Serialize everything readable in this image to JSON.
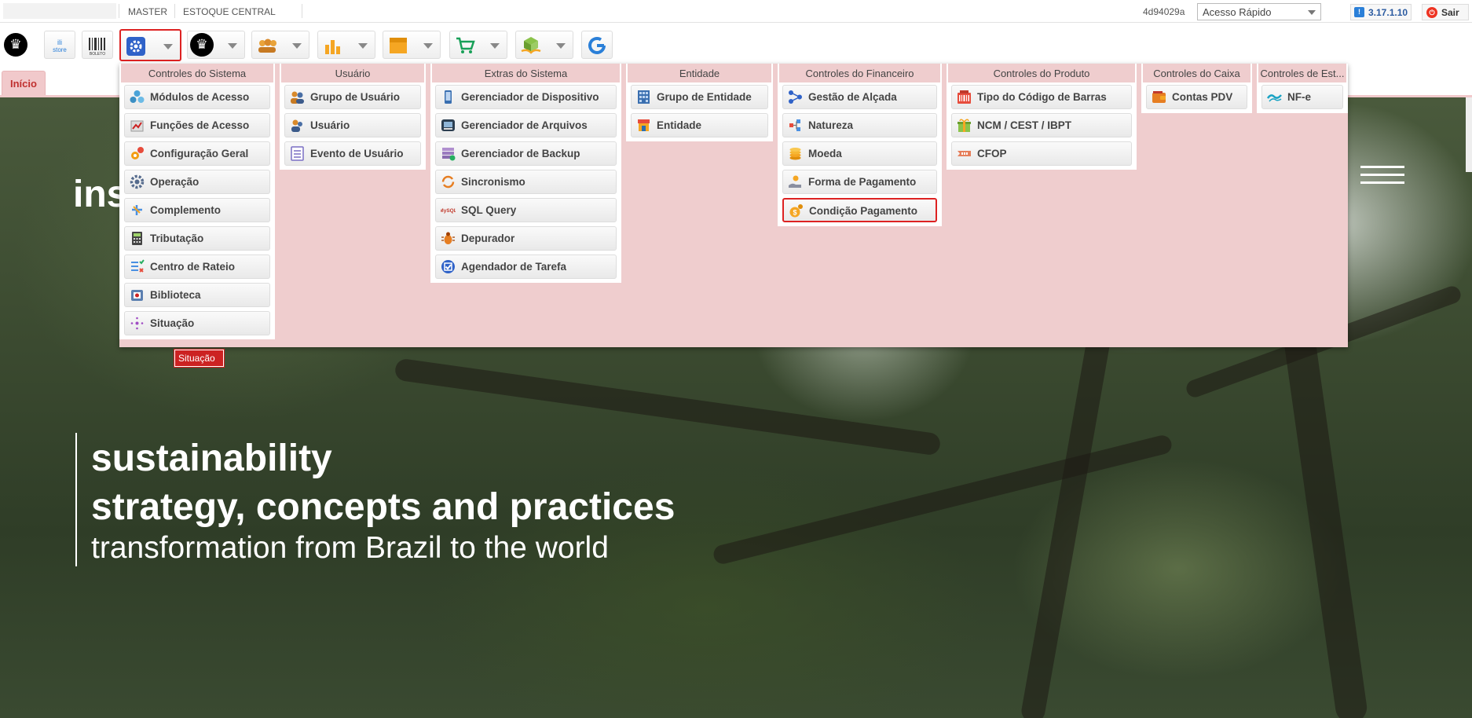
{
  "topbar": {
    "context1": "MASTER",
    "context2": "ESTOQUE CENTRAL",
    "build_hash": "4d94029a",
    "quick_access_value": "Acesso Rápido",
    "version": "3.17.1.10",
    "logout_label": "Sair"
  },
  "toolbar": {
    "buttons": [
      {
        "name": "crown-logo-icon"
      },
      {
        "name": "store-icon",
        "label": "store"
      },
      {
        "name": "barcode-icon",
        "label": "BOLETO"
      },
      {
        "name": "settings-gear-icon",
        "selected": true
      },
      {
        "name": "crown-menu-icon"
      },
      {
        "name": "users-icon"
      },
      {
        "name": "chart-icon"
      },
      {
        "name": "box-icon"
      },
      {
        "name": "cart-icon"
      },
      {
        "name": "package-hand-icon"
      },
      {
        "name": "refresh-g-icon"
      }
    ]
  },
  "tabs": {
    "home": "Início"
  },
  "hero": {
    "brand_fragment": "ins",
    "line1": "sustainability",
    "line2": "strategy, concepts and practices",
    "line3": "transformation from Brazil to the world"
  },
  "menu": {
    "columns": [
      {
        "title": "Controles do Sistema",
        "items": [
          {
            "label": "Módulos de Acesso",
            "icon": "modules-icon"
          },
          {
            "label": "Funções de Acesso",
            "icon": "functions-icon"
          },
          {
            "label": "Configuração Geral",
            "icon": "config-gears-icon"
          },
          {
            "label": "Operação",
            "icon": "operation-gear-icon"
          },
          {
            "label": "Complemento",
            "icon": "complement-icon"
          },
          {
            "label": "Tributação",
            "icon": "calculator-icon"
          },
          {
            "label": "Centro de Rateio",
            "icon": "checklist-icon"
          },
          {
            "label": "Biblioteca",
            "icon": "library-icon"
          },
          {
            "label": "Situação",
            "icon": "status-dots-icon"
          }
        ]
      },
      {
        "title": "Usuário",
        "items": [
          {
            "label": "Grupo de Usuário",
            "icon": "user-group-icon"
          },
          {
            "label": "Usuário",
            "icon": "user-icon"
          },
          {
            "label": "Evento de Usuário",
            "icon": "event-list-icon"
          }
        ]
      },
      {
        "title": "Extras do Sistema",
        "items": [
          {
            "label": "Gerenciador de Dispositivo",
            "icon": "device-icon"
          },
          {
            "label": "Gerenciador de Arquivos",
            "icon": "file-manager-icon"
          },
          {
            "label": "Gerenciador de Backup",
            "icon": "backup-icon"
          },
          {
            "label": "Sincronismo",
            "icon": "sync-icon"
          },
          {
            "label": "SQL Query",
            "icon": "mysql-icon"
          },
          {
            "label": "Depurador",
            "icon": "bug-icon"
          },
          {
            "label": "Agendador de Tarefa",
            "icon": "task-check-icon"
          }
        ]
      },
      {
        "title": "Entidade",
        "items": [
          {
            "label": "Grupo de Entidade",
            "icon": "building-icon"
          },
          {
            "label": "Entidade",
            "icon": "store-front-icon"
          }
        ]
      },
      {
        "title": "Controles do Financeiro",
        "items": [
          {
            "label": "Gestão de Alçada",
            "icon": "hierarchy-icon"
          },
          {
            "label": "Natureza",
            "icon": "nature-icon"
          },
          {
            "label": "Moeda",
            "icon": "coins-icon"
          },
          {
            "label": "Forma de Pagamento",
            "icon": "payment-hand-icon"
          },
          {
            "label": "Condição Pagamento",
            "icon": "payment-condition-icon",
            "highlighted": true
          }
        ]
      },
      {
        "title": "Controles do Produto",
        "items": [
          {
            "label": "Tipo do Código de Barras",
            "icon": "barcode-type-icon"
          },
          {
            "label": "NCM / CEST / IBPT",
            "icon": "ncm-icon"
          },
          {
            "label": "CFOP",
            "icon": "cfop-icon"
          }
        ]
      },
      {
        "title": "Controles do Caixa",
        "items": [
          {
            "label": "Contas PDV",
            "icon": "wallet-icon"
          }
        ]
      },
      {
        "title": "Controles de Est...",
        "items": [
          {
            "label": "NF-e",
            "icon": "nfe-icon"
          }
        ]
      }
    ]
  },
  "tooltip": {
    "text": "Situação"
  },
  "colors": {
    "accent_red": "#d22222",
    "panel_pink": "#efcdce"
  }
}
